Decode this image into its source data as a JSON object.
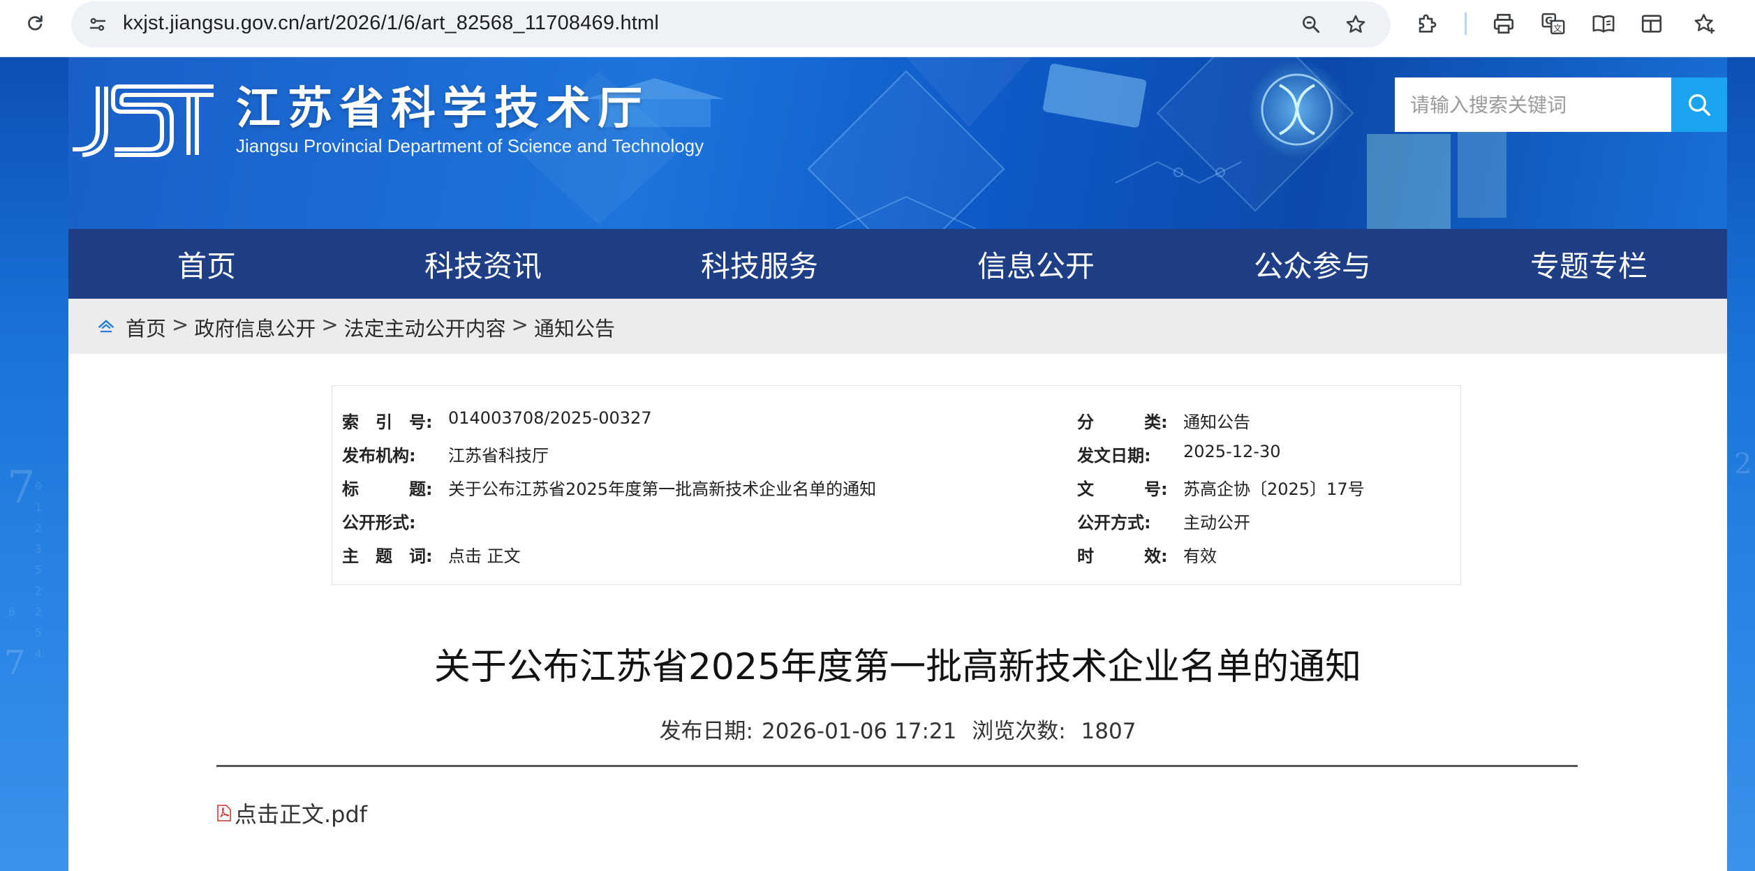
{
  "browser": {
    "url": "kxjst.jiangsu.gov.cn/art/2026/1/6/art_82568_11708469.html"
  },
  "site": {
    "title_cn": "江苏省科学技术厅",
    "title_en": "Jiangsu Provincial Department of Science and Technology",
    "search_placeholder": "请输入搜索关键词"
  },
  "nav": [
    {
      "label": "首页"
    },
    {
      "label": "科技资讯"
    },
    {
      "label": "科技服务"
    },
    {
      "label": "信息公开"
    },
    {
      "label": "公众参与"
    },
    {
      "label": "专题专栏"
    }
  ],
  "breadcrumb": {
    "items": [
      "首页",
      "政府信息公开",
      "法定主动公开内容",
      "通知公告"
    ],
    "separator": ">"
  },
  "meta": {
    "left": [
      {
        "label": "索　引　号:",
        "value": "014003708/2025-00327"
      },
      {
        "label": "发布机构:",
        "value": "江苏省科技厅"
      },
      {
        "label": "标　　　题:",
        "value": "关于公布江苏省2025年度第一批高新技术企业名单的通知"
      },
      {
        "label": "公开形式:",
        "value": ""
      },
      {
        "label": "主　题　词:",
        "value": "点击 正文"
      }
    ],
    "right": [
      {
        "label": "分　　　类:",
        "value": "通知公告"
      },
      {
        "label": "发文日期:",
        "value": "2025-12-30"
      },
      {
        "label": "文　　　号:",
        "value": "苏高企协〔2025〕17号"
      },
      {
        "label": "公开方式:",
        "value": "主动公开"
      },
      {
        "label": "时　　　效:",
        "value": "有效"
      }
    ]
  },
  "article": {
    "title": "关于公布江苏省2025年度第一批高新技术企业名单的通知",
    "pub_date_label": "发布日期:",
    "pub_date": "2026-01-06 17:21",
    "views_label": "浏览次数:",
    "views": "1807",
    "attachment": "点击正文.pdf"
  },
  "colors": {
    "nav_bg": "#1e3f85",
    "search_button": "#1aa3ee",
    "banner_blue": "#1a6fd6",
    "breadcrumb_bg": "#ececec"
  },
  "icons": {
    "reload": "reload-icon",
    "site_info": "tune-icon",
    "zoom": "zoom-icon",
    "bookmark": "star-icon",
    "extensions": "puzzle-icon",
    "print": "print-icon",
    "translate": "translate-icon",
    "reader": "book-icon",
    "sidebar": "sidebar-icon",
    "favorites": "favorites-icon",
    "search": "search-icon",
    "home": "home-icon",
    "pdf": "pdf-icon"
  }
}
